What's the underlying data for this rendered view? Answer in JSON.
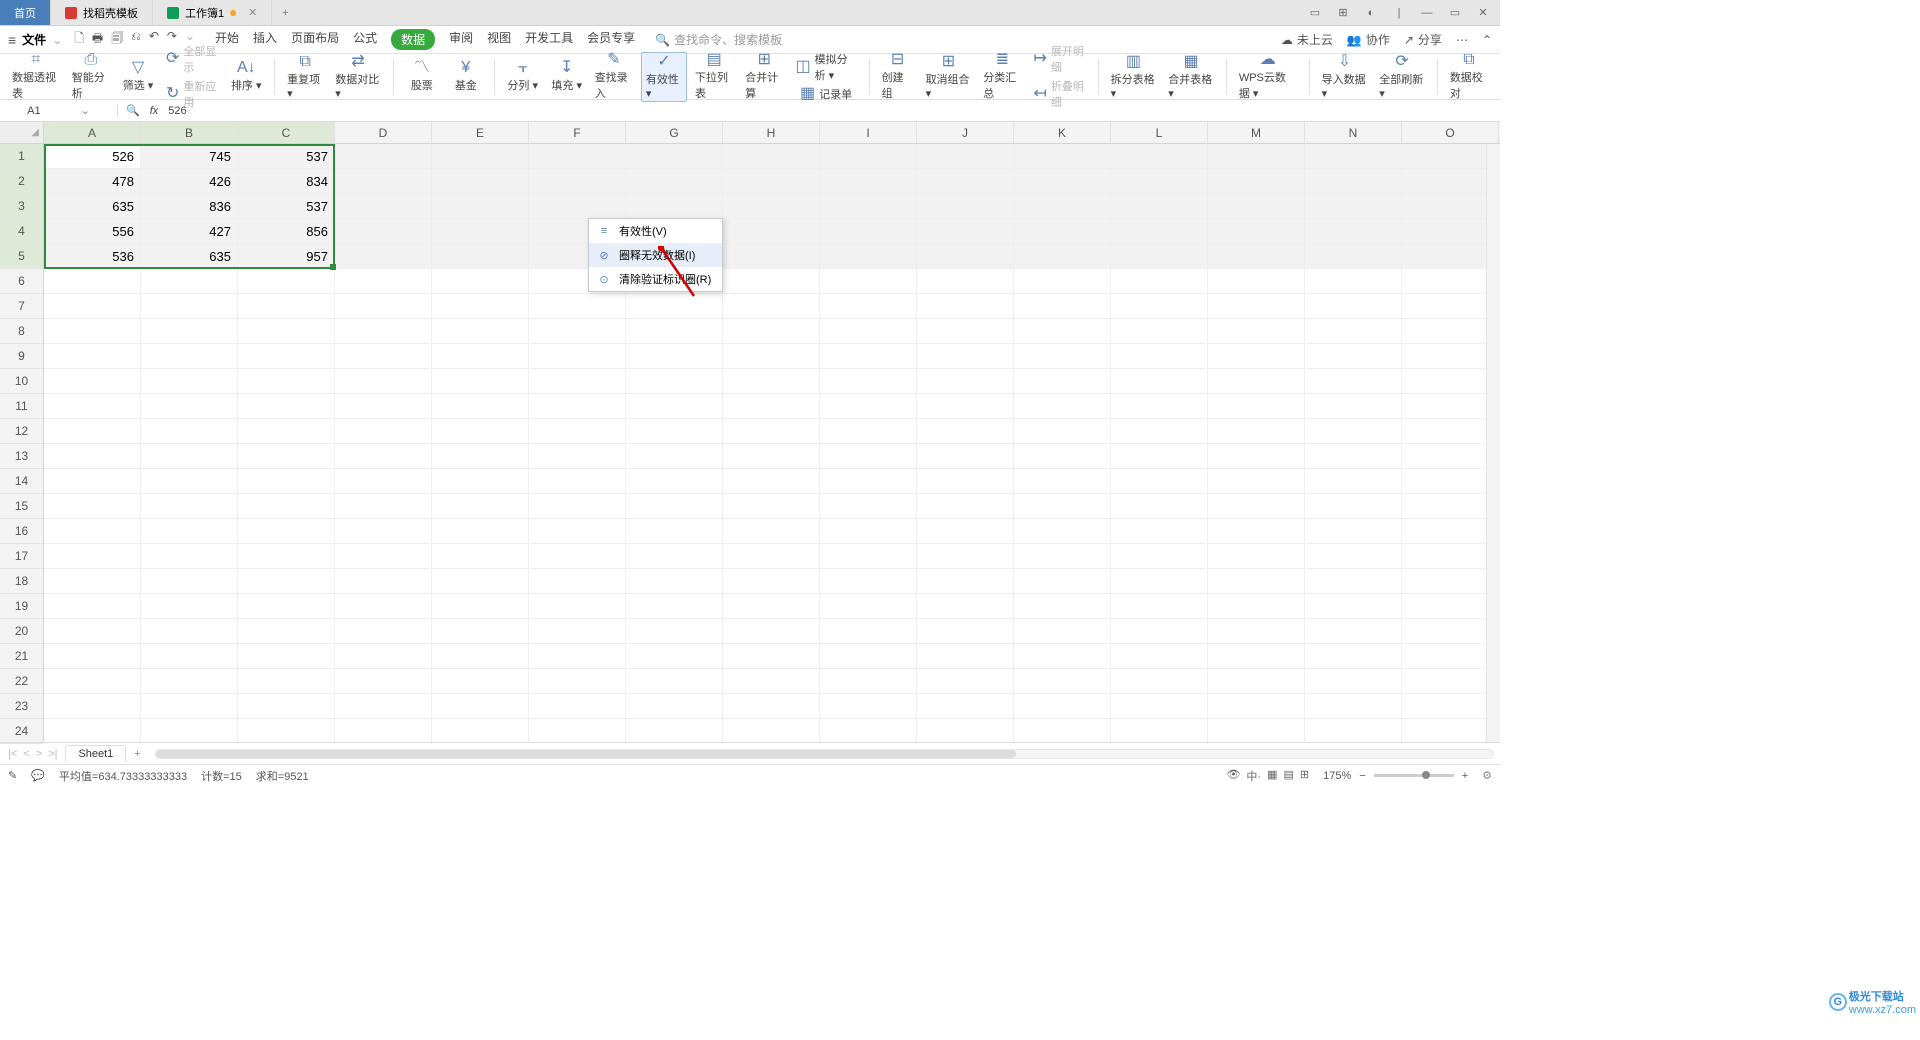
{
  "titlebar": {
    "home": "首页",
    "tab_templates": "找稻壳模板",
    "tab_workbook": "工作簿1",
    "add": "+"
  },
  "win": {
    "min": "—",
    "max": "▭",
    "close": "✕"
  },
  "menubar": {
    "hamburger": "≡",
    "file": "文件",
    "qat": [
      "🗋",
      "🖶",
      "🗐",
      "⎌",
      "↶",
      "↷"
    ],
    "tabs": [
      "开始",
      "插入",
      "页面布局",
      "公式",
      "数据",
      "审阅",
      "视图",
      "开发工具",
      "会员专享"
    ],
    "active_index": 4,
    "search_placeholder": "查找命令、搜索模板",
    "cloud": "未上云",
    "coop": "协作",
    "share": "分享"
  },
  "ribbon": {
    "items": [
      {
        "ic": "⌗",
        "t": "数据透视表"
      },
      {
        "ic": "⎙",
        "t": "智能分析"
      },
      {
        "ic": "▽",
        "t": "筛选",
        "dd": true
      },
      {
        "stack": [
          {
            "ic": "⟳",
            "t": "全部显示",
            "dim": true
          },
          {
            "ic": "↻",
            "t": "重新应用",
            "dim": true
          }
        ]
      },
      {
        "ic": "A↓",
        "t": "排序",
        "dd": true
      },
      {
        "sep": true
      },
      {
        "ic": "⧉",
        "t": "重复项",
        "dd": true
      },
      {
        "ic": "⇄",
        "t": "数据对比",
        "dd": true
      },
      {
        "sep": true
      },
      {
        "ic": "〽",
        "t": "股票"
      },
      {
        "ic": "¥",
        "t": "基金"
      },
      {
        "sep": true
      },
      {
        "ic": "⫟",
        "t": "分列",
        "dd": true
      },
      {
        "ic": "↧",
        "t": "填充",
        "dd": true
      },
      {
        "ic": "✎",
        "t": "查找录入"
      },
      {
        "ic": "✓",
        "t": "有效性",
        "dd": true,
        "hl": true
      },
      {
        "ic": "▤",
        "t": "下拉列表"
      },
      {
        "ic": "⊞",
        "t": "合并计算"
      },
      {
        "stack": [
          {
            "ic": "◫",
            "t": "模拟分析",
            "dd": true
          },
          {
            "ic": "▦",
            "t": "记录单"
          }
        ]
      },
      {
        "sep": true
      },
      {
        "ic": "⊟",
        "t": "创建组"
      },
      {
        "ic": "⊞",
        "t": "取消组合",
        "dd": true
      },
      {
        "ic": "≣",
        "t": "分类汇总"
      },
      {
        "stack": [
          {
            "ic": "↦",
            "t": "展开明细",
            "dim": true
          },
          {
            "ic": "↤",
            "t": "折叠明细",
            "dim": true
          }
        ]
      },
      {
        "sep": true
      },
      {
        "ic": "▥",
        "t": "拆分表格",
        "dd": true
      },
      {
        "ic": "▦",
        "t": "合并表格",
        "dd": true
      },
      {
        "sep": true
      },
      {
        "ic": "☁",
        "t": "WPS云数据",
        "dd": true
      },
      {
        "sep": true
      },
      {
        "ic": "⇩",
        "t": "导入数据",
        "dd": true
      },
      {
        "ic": "⟳",
        "t": "全部刷新",
        "dd": true
      },
      {
        "sep": true
      },
      {
        "ic": "⧉",
        "t": "数据校对"
      }
    ]
  },
  "formula_bar": {
    "namebox": "A1",
    "fx": "fx",
    "value": "526"
  },
  "columns": [
    "A",
    "B",
    "C",
    "D",
    "E",
    "F",
    "G",
    "H",
    "I",
    "J",
    "K",
    "L",
    "M",
    "N",
    "O"
  ],
  "row_count": 24,
  "sel": {
    "cols": 3,
    "rows": 5
  },
  "grid_data": [
    [
      "526",
      "745",
      "537"
    ],
    [
      "478",
      "426",
      "834"
    ],
    [
      "635",
      "836",
      "537"
    ],
    [
      "556",
      "427",
      "856"
    ],
    [
      "536",
      "635",
      "957"
    ]
  ],
  "dropdown": {
    "items": [
      {
        "ic": "≡",
        "t": "有效性(V)"
      },
      {
        "ic": "⊘",
        "t": "圈释无效数据(I)",
        "hover": true
      },
      {
        "ic": "⊙",
        "t": "清除验证标识圈(R)"
      }
    ]
  },
  "sheetbar": {
    "sheet": "Sheet1",
    "add": "+"
  },
  "status": {
    "avg_label": "平均值=",
    "avg": "634.73333333333",
    "count_label": "计数=",
    "count": "15",
    "sum_label": "求和=",
    "sum": "9521",
    "zoom": "175%"
  },
  "watermark": {
    "brand": "极光下载站",
    "url": "www.xz7.com"
  }
}
